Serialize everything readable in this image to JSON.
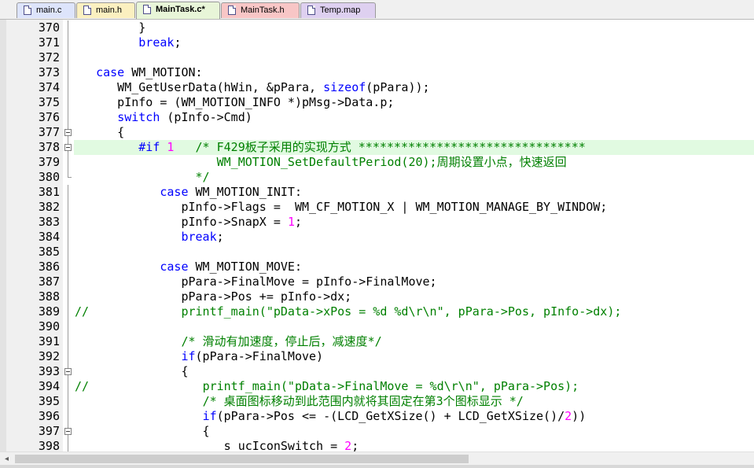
{
  "tabs": [
    {
      "label": "main.c",
      "bg": "#dde4fb",
      "active": false,
      "icon": "c-file-icon"
    },
    {
      "label": "main.h",
      "bg": "#fbf0c0",
      "active": false,
      "icon": "h-file-icon"
    },
    {
      "label": "MainTask.c*",
      "bg": "#e8f5d8",
      "active": true,
      "icon": "c-file-icon"
    },
    {
      "label": "MainTask.h",
      "bg": "#f8c6c6",
      "active": false,
      "icon": "h-file-icon"
    },
    {
      "label": "Temp.map",
      "bg": "#ded0f0",
      "active": false,
      "icon": "map-file-icon"
    }
  ],
  "editor": {
    "highlighted_line": 378,
    "lines": [
      {
        "n": "370",
        "fold": "bar",
        "tokens": [
          [
            "p",
            "         }"
          ]
        ]
      },
      {
        "n": "371",
        "fold": "bar",
        "tokens": [
          [
            "p",
            "         "
          ],
          [
            "kw",
            "break"
          ],
          [
            "p",
            ";"
          ]
        ]
      },
      {
        "n": "372",
        "fold": "bar",
        "tokens": []
      },
      {
        "n": "373",
        "fold": "bar",
        "tokens": [
          [
            "p",
            "   "
          ],
          [
            "kw",
            "case"
          ],
          [
            "p",
            " WM_MOTION:"
          ]
        ]
      },
      {
        "n": "374",
        "fold": "bar",
        "tokens": [
          [
            "p",
            "      WM_GetUserData(hWin, &pPara, "
          ],
          [
            "kw",
            "sizeof"
          ],
          [
            "p",
            "(pPara));"
          ]
        ]
      },
      {
        "n": "375",
        "fold": "bar",
        "tokens": [
          [
            "p",
            "      pInfo = (WM_MOTION_INFO *)pMsg->Data.p;"
          ]
        ]
      },
      {
        "n": "376",
        "fold": "bar",
        "tokens": [
          [
            "p",
            "      "
          ],
          [
            "kw",
            "switch"
          ],
          [
            "p",
            " (pInfo->Cmd)"
          ]
        ]
      },
      {
        "n": "377",
        "fold": "box",
        "tokens": [
          [
            "p",
            "      {"
          ]
        ]
      },
      {
        "n": "378",
        "fold": "box",
        "tokens": [
          [
            "p",
            "         "
          ],
          [
            "pp",
            "#if"
          ],
          [
            "p",
            " "
          ],
          [
            "num",
            "1"
          ],
          [
            "p",
            "   "
          ],
          [
            "com",
            "/* F429板子采用的实现方式 ********************************"
          ]
        ]
      },
      {
        "n": "379",
        "fold": "bar",
        "tokens": [
          [
            "com",
            "                    WM_MOTION_SetDefaultPeriod(20);周期设置小点，快速返回"
          ]
        ]
      },
      {
        "n": "380",
        "fold": "end",
        "tokens": [
          [
            "com",
            "                 */"
          ]
        ]
      },
      {
        "n": "381",
        "fold": "bar",
        "tokens": [
          [
            "p",
            "            "
          ],
          [
            "kw",
            "case"
          ],
          [
            "p",
            " WM_MOTION_INIT:"
          ]
        ]
      },
      {
        "n": "382",
        "fold": "bar",
        "tokens": [
          [
            "p",
            "               pInfo->Flags =  WM_CF_MOTION_X | WM_MOTION_MANAGE_BY_WINDOW;"
          ]
        ]
      },
      {
        "n": "383",
        "fold": "bar",
        "tokens": [
          [
            "p",
            "               pInfo->SnapX = "
          ],
          [
            "num",
            "1"
          ],
          [
            "p",
            ";"
          ]
        ]
      },
      {
        "n": "384",
        "fold": "bar",
        "tokens": [
          [
            "p",
            "               "
          ],
          [
            "kw",
            "break"
          ],
          [
            "p",
            ";"
          ]
        ]
      },
      {
        "n": "385",
        "fold": "bar",
        "tokens": []
      },
      {
        "n": "386",
        "fold": "bar",
        "tokens": [
          [
            "p",
            "            "
          ],
          [
            "kw",
            "case"
          ],
          [
            "p",
            " WM_MOTION_MOVE:"
          ]
        ]
      },
      {
        "n": "387",
        "fold": "bar",
        "tokens": [
          [
            "p",
            "               pPara->FinalMove = pInfo->FinalMove;"
          ]
        ]
      },
      {
        "n": "388",
        "fold": "bar",
        "tokens": [
          [
            "p",
            "               pPara->Pos += pInfo->dx;"
          ]
        ]
      },
      {
        "n": "389",
        "fold": "bar",
        "tokens": [
          [
            "com",
            "//             "
          ],
          [
            "com",
            "printf_main(\"pData->xPos = %d %d\\r\\n\", pPara->Pos, pInfo->dx);"
          ]
        ]
      },
      {
        "n": "390",
        "fold": "bar",
        "tokens": []
      },
      {
        "n": "391",
        "fold": "bar",
        "tokens": [
          [
            "p",
            "               "
          ],
          [
            "com",
            "/* 滑动有加速度，停止后，减速度*/"
          ]
        ]
      },
      {
        "n": "392",
        "fold": "bar",
        "tokens": [
          [
            "p",
            "               "
          ],
          [
            "kw",
            "if"
          ],
          [
            "p",
            "(pPara->FinalMove)"
          ]
        ]
      },
      {
        "n": "393",
        "fold": "box",
        "tokens": [
          [
            "p",
            "               {"
          ]
        ]
      },
      {
        "n": "394",
        "fold": "bar",
        "tokens": [
          [
            "com",
            "//                "
          ],
          [
            "com",
            "printf_main(\"pData->FinalMove = %d\\r\\n\", pPara->Pos);"
          ]
        ]
      },
      {
        "n": "395",
        "fold": "bar",
        "tokens": [
          [
            "p",
            "                  "
          ],
          [
            "com",
            "/* 桌面图标移动到此范围内就将其固定在第3个图标显示 */"
          ]
        ]
      },
      {
        "n": "396",
        "fold": "bar",
        "tokens": [
          [
            "p",
            "                  "
          ],
          [
            "kw",
            "if"
          ],
          [
            "p",
            "(pPara->Pos <= -(LCD_GetXSize() + LCD_GetXSize()/"
          ],
          [
            "num",
            "2"
          ],
          [
            "p",
            "))"
          ]
        ]
      },
      {
        "n": "397",
        "fold": "box",
        "tokens": [
          [
            "p",
            "                  {"
          ]
        ]
      },
      {
        "n": "398",
        "fold": "bar",
        "tokens": [
          [
            "p",
            "                     s_ucIconSwitch = "
          ],
          [
            "num",
            "2"
          ],
          [
            "p",
            ";"
          ]
        ]
      }
    ]
  },
  "scrollbar": {
    "left_arrow": "◂",
    "thumb_fraction": 0.62
  }
}
